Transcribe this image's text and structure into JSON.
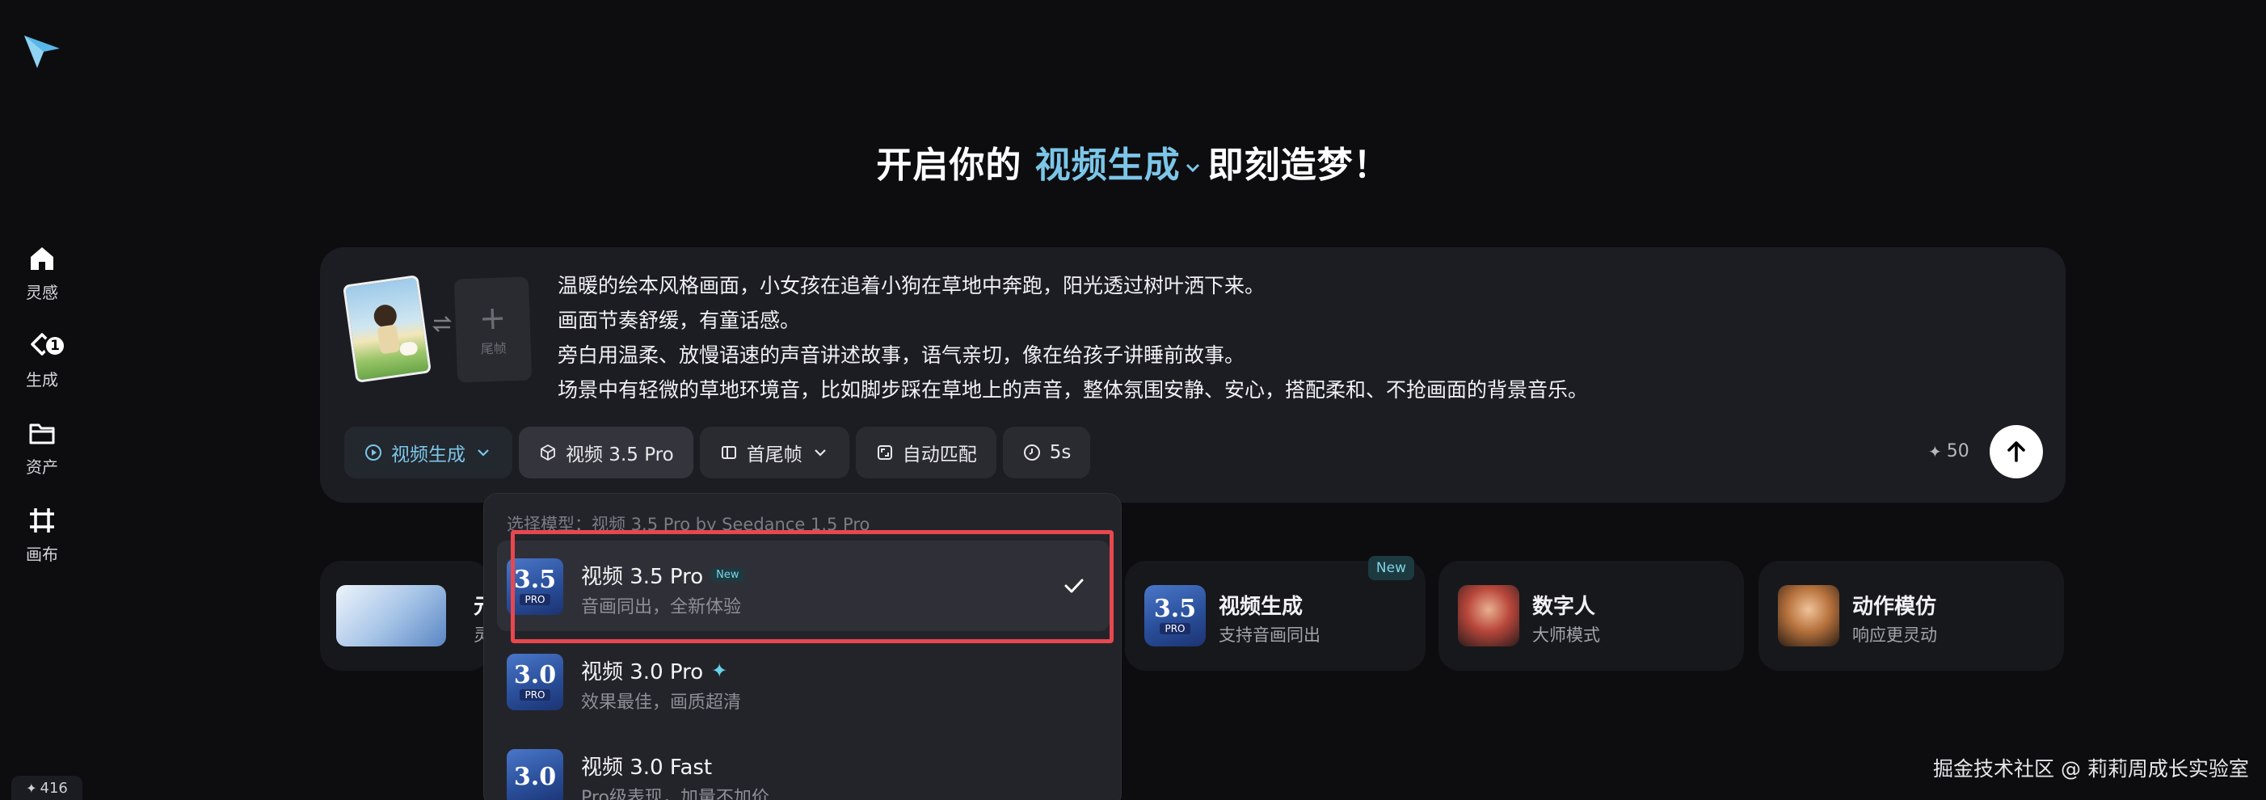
{
  "sidebar": {
    "items": [
      {
        "label": "灵感",
        "icon": "home-icon"
      },
      {
        "label": "生成",
        "icon": "generate-icon",
        "badge": "1"
      },
      {
        "label": "资产",
        "icon": "folder-icon"
      },
      {
        "label": "画布",
        "icon": "canvas-icon"
      }
    ],
    "credits": "416"
  },
  "headline": {
    "prefix": "开启你的",
    "accent": "视频生成",
    "suffix": "即刻造梦！"
  },
  "prompt": {
    "tail_frame_label": "尾帧",
    "lines": [
      "温暖的绘本风格画面，小女孩在追着小狗在草地中奔跑，阳光透过树叶洒下来。",
      "画面节奏舒缓，有童话感。",
      "旁白用温柔、放慢语速的声音讲述故事，语气亲切，像在给孩子讲睡前故事。",
      "场景中有轻微的草地环境音，比如脚步踩在草地上的声音，整体氛围安静、安心，搭配柔和、不抢画面的背景音乐。"
    ]
  },
  "toolbar": {
    "mode": "视频生成",
    "model": "视频 3.5 Pro",
    "frames": "首尾帧",
    "ratio": "自动匹配",
    "duration": "5s",
    "cost": "50"
  },
  "features": [
    {
      "title": "元",
      "sub": "灵"
    },
    {
      "title": "视频生成",
      "sub": "支持音画同出",
      "tag": "New"
    },
    {
      "title": "数字人",
      "sub": "大师模式"
    },
    {
      "title": "动作模仿",
      "sub": "响应更灵动"
    }
  ],
  "dropdown": {
    "label": "选择模型：视频 3.5 Pro by Seedance 1.5 Pro",
    "items": [
      {
        "title": "视频 3.5 Pro",
        "tag": "New",
        "sub": "音画同出，全新体验",
        "ver": "3.5",
        "selected": true
      },
      {
        "title": "视频 3.0 Pro",
        "sub": "效果最佳，画质超清",
        "ver": "3.0"
      },
      {
        "title": "视频 3.0 Fast",
        "sub": "Pro级表现，加量不加价",
        "ver": "3.0"
      }
    ],
    "pro_badge": "PRO"
  },
  "watermark": "掘金技术社区 @ 莉莉周成长实验室",
  "colors": {
    "accent": "#7cc6e8",
    "highlight": "#e8474f",
    "background": "#0d0d10"
  }
}
